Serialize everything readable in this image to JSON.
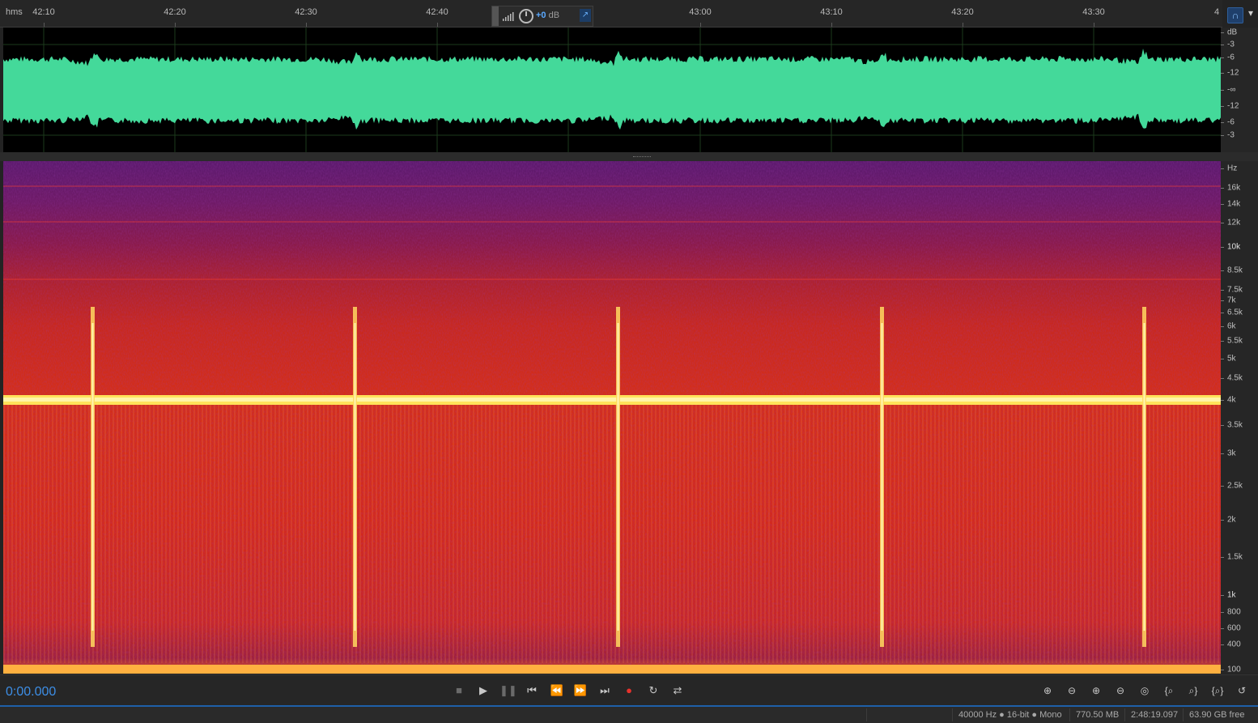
{
  "ruler": {
    "unit_label": "hms",
    "ticks": [
      "42:10",
      "42:20",
      "42:30",
      "42:40",
      "43:00",
      "43:10",
      "43:20",
      "43:30",
      "4"
    ]
  },
  "hud": {
    "gain_value": "+0",
    "gain_unit": "dB"
  },
  "waveform": {
    "color": "#44d99a",
    "db_labels": [
      "dB",
      "-3",
      "-6",
      "-12",
      "-∞",
      "-12",
      "-6",
      "-3"
    ]
  },
  "spectrogram": {
    "hz_labels": [
      "Hz",
      "16k",
      "14k",
      "12k",
      "10k",
      "8.5k",
      "7.5k",
      "7k",
      "6.5k",
      "6k",
      "5.5k",
      "5k",
      "4.5k",
      "4k",
      "3.5k",
      "3k",
      "2.5k",
      "2k",
      "1.5k",
      "1k",
      "800",
      "600",
      "400",
      "100"
    ],
    "colors": {
      "low": "#5c1a6e",
      "mid": "#d42a1a",
      "high": "#ffef8a"
    }
  },
  "transport": {
    "timecode": "0:00.000",
    "buttons": [
      {
        "name": "stop-button",
        "icon": "■",
        "disabled": true
      },
      {
        "name": "play-button",
        "icon": "▶",
        "disabled": false
      },
      {
        "name": "pause-button",
        "icon": "❚❚",
        "disabled": true
      },
      {
        "name": "skip-to-start-button",
        "icon": "⏮",
        "disabled": false
      },
      {
        "name": "rewind-button",
        "icon": "⏪",
        "disabled": false
      },
      {
        "name": "fast-forward-button",
        "icon": "⏩",
        "disabled": false
      },
      {
        "name": "skip-to-end-button",
        "icon": "⏭",
        "disabled": false
      },
      {
        "name": "record-button",
        "icon": "●",
        "disabled": false
      },
      {
        "name": "loop-playback-button",
        "icon": "↻",
        "disabled": false
      },
      {
        "name": "skip-selection-button",
        "icon": "⇄",
        "disabled": false
      }
    ],
    "zoom_buttons": [
      "zoom-in-amplitude-button",
      "zoom-out-amplitude-button",
      "zoom-in-time-button",
      "zoom-out-time-button",
      "zoom-selection-button",
      "zoom-in-left-button",
      "zoom-in-right-button",
      "zoom-out-full-button",
      "reset-zoom-button"
    ]
  },
  "status": {
    "format": "40000 Hz ● 16-bit ● Mono",
    "size": "770.50 MB",
    "duration": "2:48:19.097",
    "free_space": "63.90 GB free"
  }
}
